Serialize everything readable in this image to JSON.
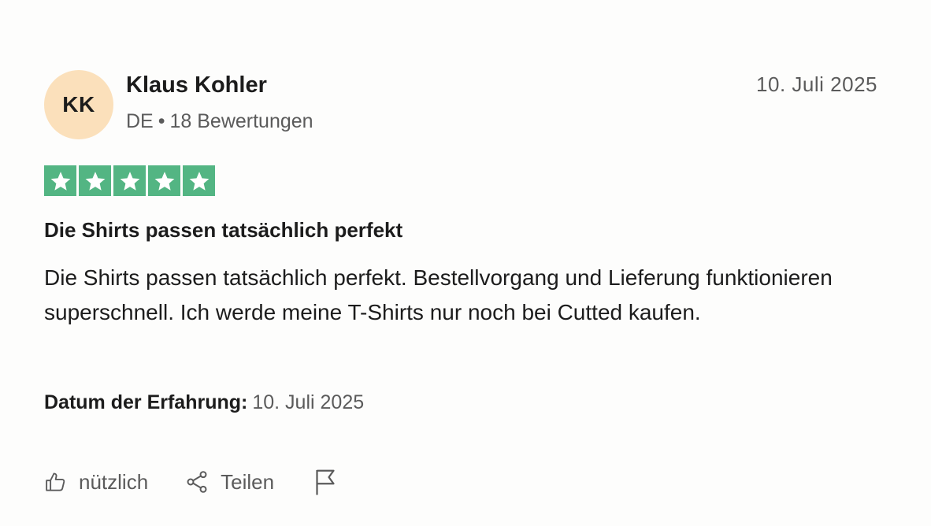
{
  "review": {
    "author": {
      "initials": "KK",
      "name": "Klaus Kohler",
      "country": "DE",
      "reviews_count": "18 Bewertungen"
    },
    "date": "10. Juli 2025",
    "rating": 5,
    "rating_max": 5,
    "star_color": "#53b583",
    "title": "Die Shirts passen tatsächlich perfekt",
    "body": "Die Shirts passen tatsächlich perfekt. Bestellvorgang und Lieferung funktionieren superschnell. Ich werde meine T-Shirts nur noch bei Cutted kaufen.",
    "experience_label": "Datum der Erfahrung:",
    "experience_date": "10. Juli 2025"
  },
  "actions": {
    "useful_label": "nützlich",
    "useful_icon": "thumbs-up-icon",
    "share_label": "Teilen",
    "share_icon": "share-icon",
    "report_icon": "flag-icon"
  }
}
